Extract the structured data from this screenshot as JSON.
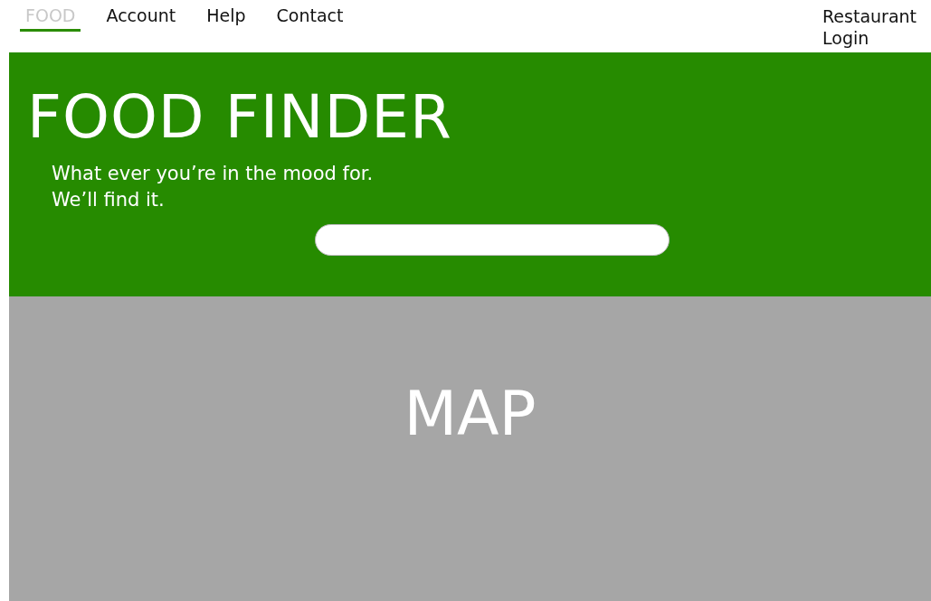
{
  "nav": {
    "items": [
      {
        "label": "FOOD",
        "selected": true
      },
      {
        "label": "Account",
        "selected": false
      },
      {
        "label": "Help",
        "selected": false
      },
      {
        "label": "Contact",
        "selected": false
      }
    ],
    "login_link": "Restaurant Login"
  },
  "hero": {
    "title": "FOOD FINDER",
    "tagline": [
      "What ever you’re in the mood for.",
      "We’ll find it."
    ]
  },
  "map": {
    "label": "MAP"
  }
}
